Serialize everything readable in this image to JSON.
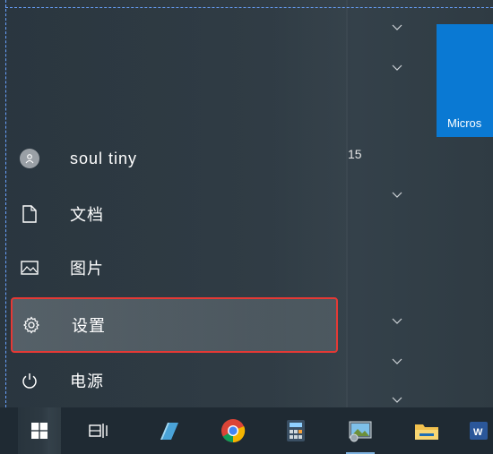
{
  "start_menu": {
    "user": {
      "name": "soul tiny"
    },
    "nav": {
      "documents": "文档",
      "pictures": "图片",
      "settings": "设置",
      "power": "电源"
    },
    "badge_text": "15"
  },
  "tiles": {
    "microsoft_label": "Micros"
  },
  "taskbar": {
    "items": [
      "start",
      "task-view",
      "notepad",
      "chrome",
      "calculator",
      "photos",
      "file-explorer",
      "word"
    ]
  },
  "colors": {
    "tile_blue": "#0a79d3",
    "highlight_border": "#e53935",
    "taskbar_bg": "#1f2a33"
  }
}
